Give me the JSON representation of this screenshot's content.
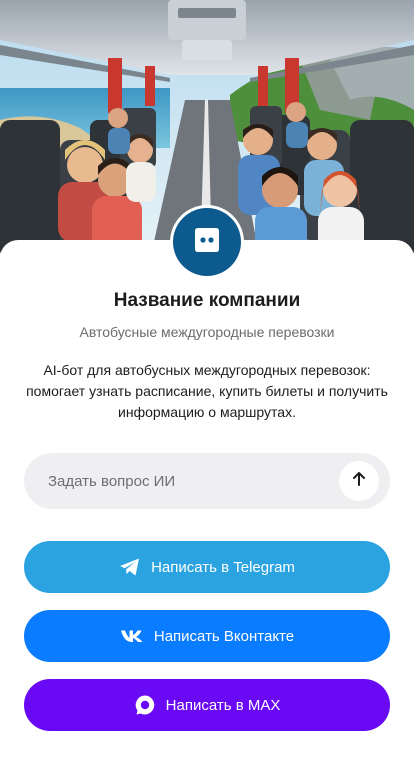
{
  "hero": {
    "icon": "bus-interior-illustration"
  },
  "company": {
    "name": "Название компании",
    "subtitle": "Автобусные междугородные перевозки",
    "description": "AI-бот для автобусных междугородных перевозок: помогает узнать расписание, купить билеты и получить информацию о маршрутах."
  },
  "ask": {
    "placeholder": "Задать вопрос ИИ",
    "icon": "arrow-up-icon"
  },
  "buttons": {
    "telegram": {
      "label": "Написать в Telegram",
      "color": "#2aa3e0"
    },
    "vk": {
      "label": "Написать Вконтакте",
      "color": "#0a7cff"
    },
    "max": {
      "label": "Написать в MAX",
      "color": "#6a0af5"
    }
  },
  "colors": {
    "avatar_bg": "#0d5a8e",
    "card_bg": "#ffffff"
  }
}
